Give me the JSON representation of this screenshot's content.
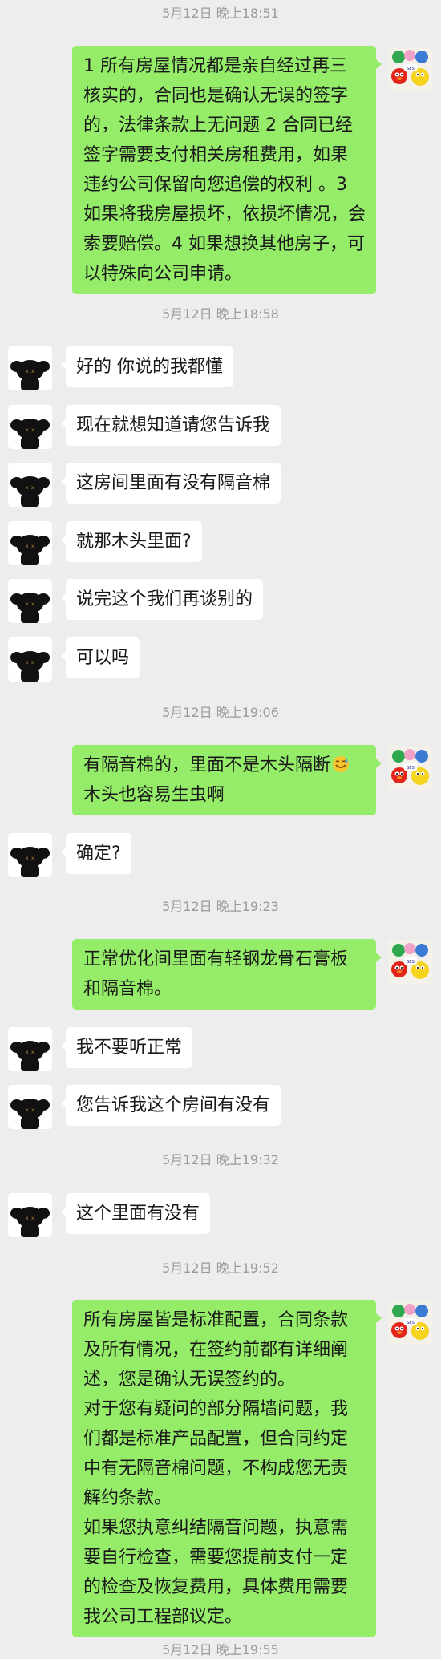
{
  "timestamps": {
    "t1": "5月12日 晚上18:51",
    "t2": "5月12日 晚上18:58",
    "t3": "5月12日 晚上19:06",
    "t4": "5月12日 晚上19:23",
    "t5": "5月12日 晚上19:32",
    "t6": "5月12日 晚上19:52",
    "t7": "5月12日 晚上19:55"
  },
  "messages": {
    "m1": {
      "sender": "self",
      "lines": [
        "1 所有房屋情况都是亲自经过再三",
        "核实的，合同也是确认无误的签字",
        "的，法律条款上无问题  2 合同已经",
        "签字需要支付相关房租费用，如果",
        "违约公司保留向您追偿的权利 。3",
        "如果将我房屋损坏，依损坏情况，会",
        "索要赔偿。4 如果想换其他房子，可",
        "以特殊向公司申请。"
      ]
    },
    "m2": {
      "sender": "other",
      "text": "好的 你说的我都懂"
    },
    "m3": {
      "sender": "other",
      "text": "现在就想知道请您告诉我"
    },
    "m4": {
      "sender": "other",
      "text": "这房间里面有没有隔音棉"
    },
    "m5": {
      "sender": "other",
      "text": "就那木头里面?"
    },
    "m6": {
      "sender": "other",
      "text": "说完这个我们再谈别的"
    },
    "m7": {
      "sender": "other",
      "text": "可以吗"
    },
    "m8": {
      "sender": "self",
      "lines": [
        "有隔音棉的，里面不是木头隔断",
        "木头也容易生虫啊"
      ],
      "emoji": "sweat-smile-emoji"
    },
    "m9": {
      "sender": "other",
      "text": "确定?"
    },
    "m10": {
      "sender": "self",
      "lines": [
        "正常优化间里面有轻钢龙骨石膏板",
        "和隔音棉。"
      ]
    },
    "m11": {
      "sender": "other",
      "text": "我不要听正常"
    },
    "m12": {
      "sender": "other",
      "text": "您告诉我这个房间有没有"
    },
    "m13": {
      "sender": "other",
      "text": "这个里面有没有"
    },
    "m14": {
      "sender": "self",
      "lines": [
        "所有房屋皆是标准配置，合同条款",
        "及所有情况，在签约前都有详细阐",
        "述，您是确认无误签约的。",
        "对于您有疑问的部分隔墙问题，我",
        "们都是标准产品配置，但合同约定",
        "中有无隔音棉问题，不构成您无责",
        "解约条款。",
        "如果您执意纠结隔音问题，执意需",
        "要自行检查，需要您提前支付一定",
        "的检查及恢复费用，具体费用需要",
        "我公司工程部议定。"
      ]
    }
  },
  "avatars": {
    "other": "kaws-figure-avatar",
    "self": "sesame-street-avatar"
  },
  "colors": {
    "background": "#ededed",
    "outgoing_bubble": "#95ec69",
    "incoming_bubble": "#ffffff",
    "timestamp": "#9b9b9b"
  }
}
